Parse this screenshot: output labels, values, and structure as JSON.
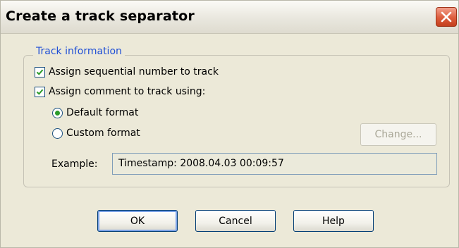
{
  "window": {
    "title": "Create a track separator"
  },
  "group": {
    "legend": "Track information",
    "sequential_label": "Assign sequential number to track",
    "sequential_checked": true,
    "comment_label": "Assign comment to track using:",
    "comment_checked": true,
    "default_format_label": "Default format",
    "default_format_selected": true,
    "custom_format_label": "Custom format",
    "custom_format_selected": false,
    "change_button_label": "Change...",
    "example_label": "Example:",
    "example_value": "Timestamp: 2008.04.03 00:09:57"
  },
  "buttons": {
    "ok": "OK",
    "cancel": "Cancel",
    "help": "Help"
  },
  "icons": {
    "close": "close-icon",
    "checkmark": "checkmark-icon"
  },
  "colors": {
    "legend": "#1f4fd6",
    "check": "#2b9b2b",
    "close": "#dc5c3c"
  }
}
